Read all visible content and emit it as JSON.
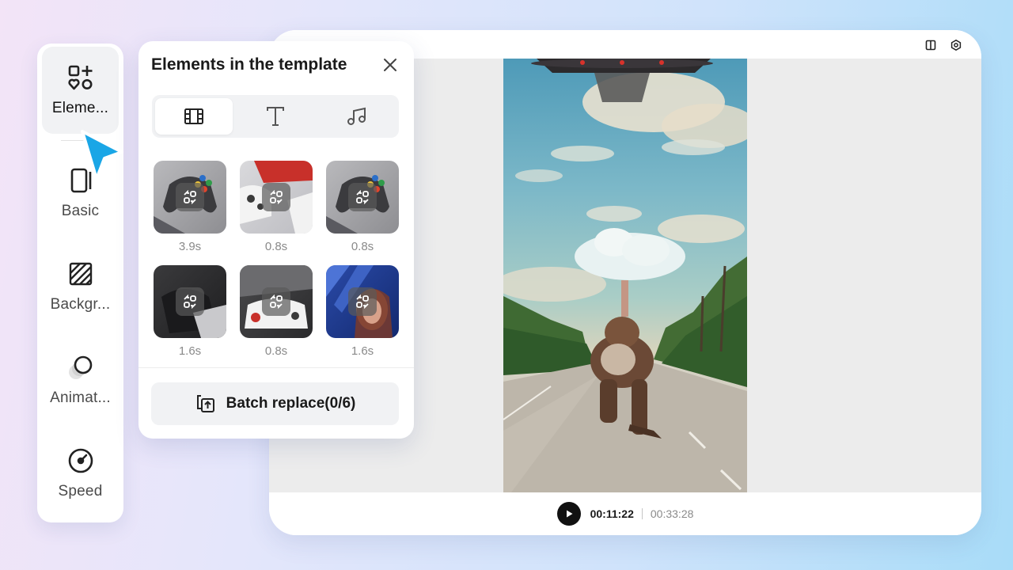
{
  "rail": {
    "items": [
      {
        "label": "Eleme...",
        "icon": "elements-icon",
        "active": true
      },
      {
        "label": "Basic",
        "icon": "basic-icon"
      },
      {
        "label": "Backgr...",
        "icon": "background-icon"
      },
      {
        "label": "Animat...",
        "icon": "animation-icon"
      },
      {
        "label": "Speed",
        "icon": "speed-icon"
      }
    ]
  },
  "panel": {
    "title": "Elements in the template",
    "tabs": [
      {
        "icon": "video-film-icon",
        "active": true
      },
      {
        "icon": "text-icon"
      },
      {
        "icon": "music-icon"
      }
    ],
    "elements": [
      {
        "duration": "3.9s"
      },
      {
        "duration": "0.8s"
      },
      {
        "duration": "0.8s"
      },
      {
        "duration": "1.6s"
      },
      {
        "duration": "0.8s"
      },
      {
        "duration": "1.6s"
      }
    ],
    "batch_label": "Batch replace(0/6)"
  },
  "player": {
    "current_time": "00:11:22",
    "total_time": "00:33:28"
  },
  "colors": {
    "accent_cursor": "#1aa6e6",
    "play_button": "#111111",
    "panel_bg": "#ffffff",
    "control_bg": "#f1f2f4"
  }
}
